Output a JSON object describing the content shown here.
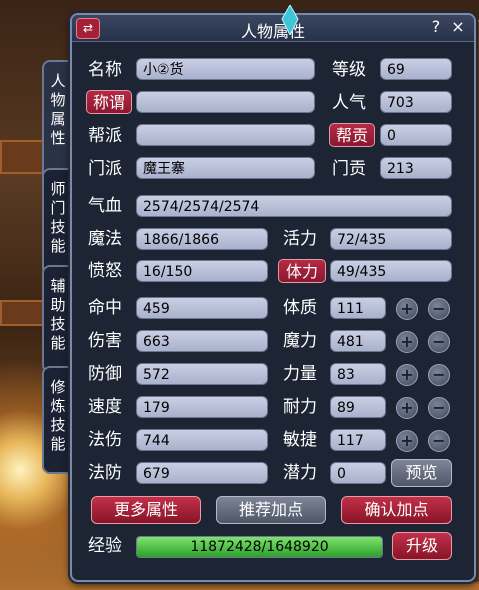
{
  "window": {
    "title": "人物属性",
    "help_label": "?",
    "close_label": "×",
    "swap_label": "⇄"
  },
  "tabs": [
    {
      "label": "人物属性",
      "active": true
    },
    {
      "label": "师门技能",
      "active": false
    },
    {
      "label": "辅助技能",
      "active": false
    },
    {
      "label": "修炼技能",
      "active": false
    }
  ],
  "basic": {
    "name_label": "名称",
    "name_value": "小②货",
    "level_label": "等级",
    "level_value": "69",
    "title_button": "称谓",
    "title_value": "",
    "popularity_label": "人气",
    "popularity_value": "703",
    "guild_label": "帮派",
    "guild_value": "",
    "guild_contrib_button": "帮贡",
    "guild_contrib_value": "0",
    "school_label": "门派",
    "school_value": "魔王寨",
    "school_contrib_label": "门贡",
    "school_contrib_value": "213"
  },
  "stats": {
    "hp_label": "气血",
    "hp_value": "2574/2574/2574",
    "mp_label": "魔法",
    "mp_value": "1866/1866",
    "vitality_label": "活力",
    "vitality_value": "72/435",
    "rage_label": "愤怒",
    "rage_value": "16/150",
    "stamina_button": "体力",
    "stamina_value": "49/435"
  },
  "combat": [
    {
      "label": "命中",
      "value": "459"
    },
    {
      "label": "伤害",
      "value": "663"
    },
    {
      "label": "防御",
      "value": "572"
    },
    {
      "label": "速度",
      "value": "179"
    },
    {
      "label": "法伤",
      "value": "744"
    },
    {
      "label": "法防",
      "value": "679"
    }
  ],
  "attributes": [
    {
      "label": "体质",
      "value": "111"
    },
    {
      "label": "魔力",
      "value": "481"
    },
    {
      "label": "力量",
      "value": "83"
    },
    {
      "label": "耐力",
      "value": "89"
    },
    {
      "label": "敏捷",
      "value": "117"
    }
  ],
  "potential": {
    "label": "潜力",
    "value": "0",
    "preview_button": "预览"
  },
  "actions": {
    "more_attributes": "更多属性",
    "recommend_points": "推荐加点",
    "confirm_points": "确认加点"
  },
  "experience": {
    "label": "经验",
    "value": "11872428/1648920",
    "fill_fraction": 1.0,
    "levelup_button": "升级"
  },
  "colors": {
    "panel_bg": "#1d2535",
    "field_bg": "#b9c0d8",
    "accent_red": "#a61f38",
    "exp_green": "#3cb634"
  }
}
